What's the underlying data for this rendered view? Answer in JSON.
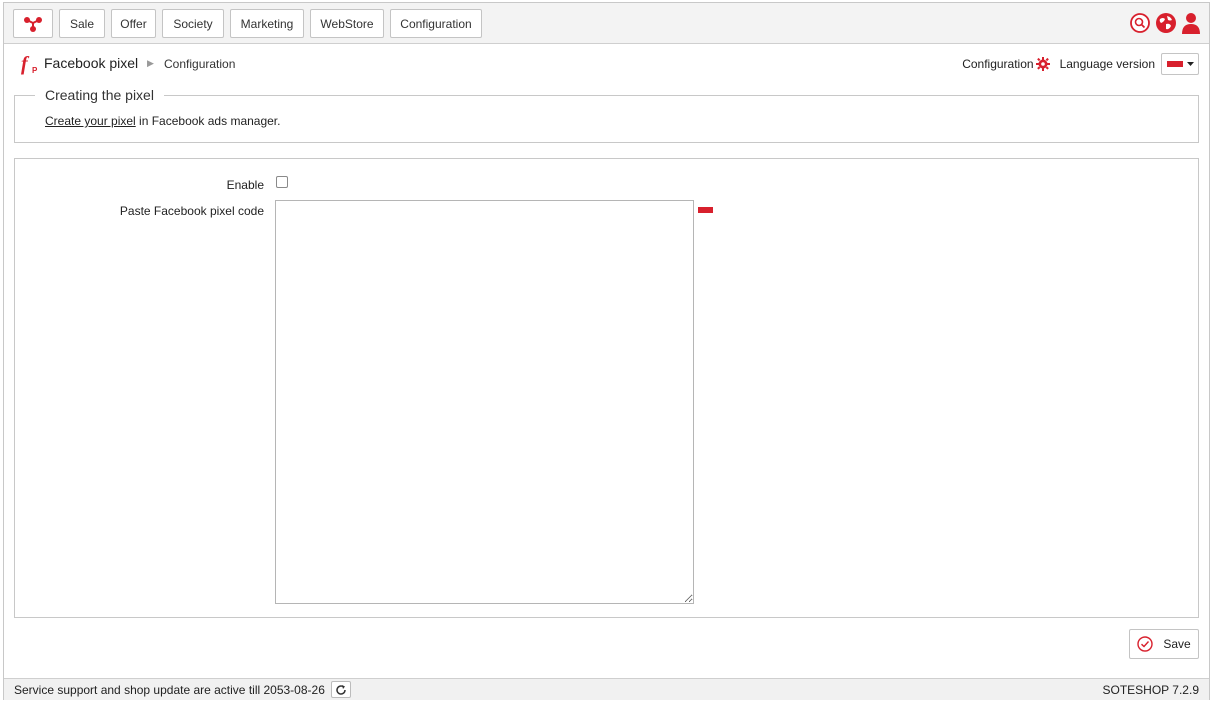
{
  "nav": {
    "logo_icon": "app-network-logo-icon",
    "items": [
      "Sale",
      "Offer",
      "Society",
      "Marketing",
      "WebStore",
      "Configuration"
    ],
    "icons": [
      "search-icon",
      "globe-icon",
      "user-icon"
    ]
  },
  "header": {
    "app_title": "Facebook pixel",
    "breadcrumb": "Configuration",
    "config_label": "Configuration",
    "language_label": "Language version"
  },
  "fieldset": {
    "legend": "Creating the pixel",
    "link_text": "Create your pixel",
    "rest_text": " in Facebook ads manager."
  },
  "form": {
    "enable_label": "Enable",
    "pixel_code_label": "Paste Facebook pixel code",
    "pixel_code_value": ""
  },
  "save_label": "Save",
  "footer": {
    "support_text": "Service support and shop update are active till 2053-08-26",
    "version": "SOTESHOP 7.2.9"
  },
  "colors": {
    "accent": "#d8202d",
    "border": "#c8c8c8"
  }
}
